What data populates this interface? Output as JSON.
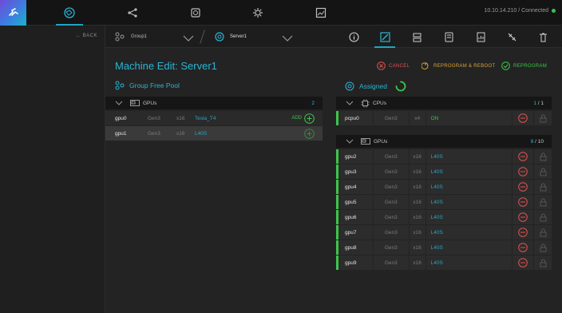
{
  "nav": {
    "icons": [
      "logo-icon",
      "nodes-icon",
      "share-icon",
      "disk-icon",
      "gear-icon",
      "image-icon"
    ],
    "status": "10.10.14.210 / Connected",
    "accent": "#1fa6c2",
    "connected_color": "#39c24a"
  },
  "left": {
    "back_label": "← BACK"
  },
  "breadcrumb": {
    "group": "Group1",
    "server": "Server1"
  },
  "toolbar": {
    "icons": [
      "info-icon",
      "edit-icon",
      "upload-icon",
      "server-icon",
      "report-icon",
      "disconnect-icon",
      "trash-icon"
    ]
  },
  "page": {
    "title": "Machine Edit: Server1",
    "cancel_label": "CANCEL",
    "reprogram_reboot_label": "REPROGRAM & REBOOT",
    "reprogram_label": "REPROGRAM",
    "pool_title": "Group Free Pool",
    "assigned_title": "Assigned"
  },
  "pool": {
    "group_label": "GPUs",
    "count": "2",
    "rows": [
      {
        "name": "gpu0",
        "gen": "Gen3",
        "width": "x16",
        "model": "Tesla_T4",
        "add": "ADD"
      },
      {
        "name": "gpu1",
        "gen": "Gen3",
        "width": "x16",
        "model": "L40S",
        "add": ""
      }
    ]
  },
  "assigned": {
    "cpu_group": {
      "label": "CPUs",
      "count_used": "1",
      "count_total": " / 1"
    },
    "cpu_rows": [
      {
        "name": "pcpu0",
        "gen": "Gen3",
        "width": "x4",
        "model": "ON"
      }
    ],
    "gpu_group": {
      "label": "GPUs",
      "count_used": "8",
      "count_total": " / 10"
    },
    "gpu_rows": [
      {
        "name": "gpu2",
        "gen": "Gen3",
        "width": "x16",
        "model": "L40S"
      },
      {
        "name": "gpu3",
        "gen": "Gen3",
        "width": "x16",
        "model": "L40S"
      },
      {
        "name": "gpu4",
        "gen": "Gen3",
        "width": "x16",
        "model": "L40S"
      },
      {
        "name": "gpu5",
        "gen": "Gen3",
        "width": "x16",
        "model": "L40S"
      },
      {
        "name": "gpu6",
        "gen": "Gen3",
        "width": "x16",
        "model": "L40S"
      },
      {
        "name": "gpu7",
        "gen": "Gen3",
        "width": "x16",
        "model": "L40S"
      },
      {
        "name": "gpu8",
        "gen": "Gen3",
        "width": "x16",
        "model": "L40S"
      },
      {
        "name": "gpu9",
        "gen": "Gen3",
        "width": "x16",
        "model": "L40S"
      }
    ]
  },
  "colors": {
    "teal": "#2ab4d4",
    "cancel": "#e05252",
    "reboot": "#d9a43a",
    "reprogram": "#3cc54a"
  }
}
